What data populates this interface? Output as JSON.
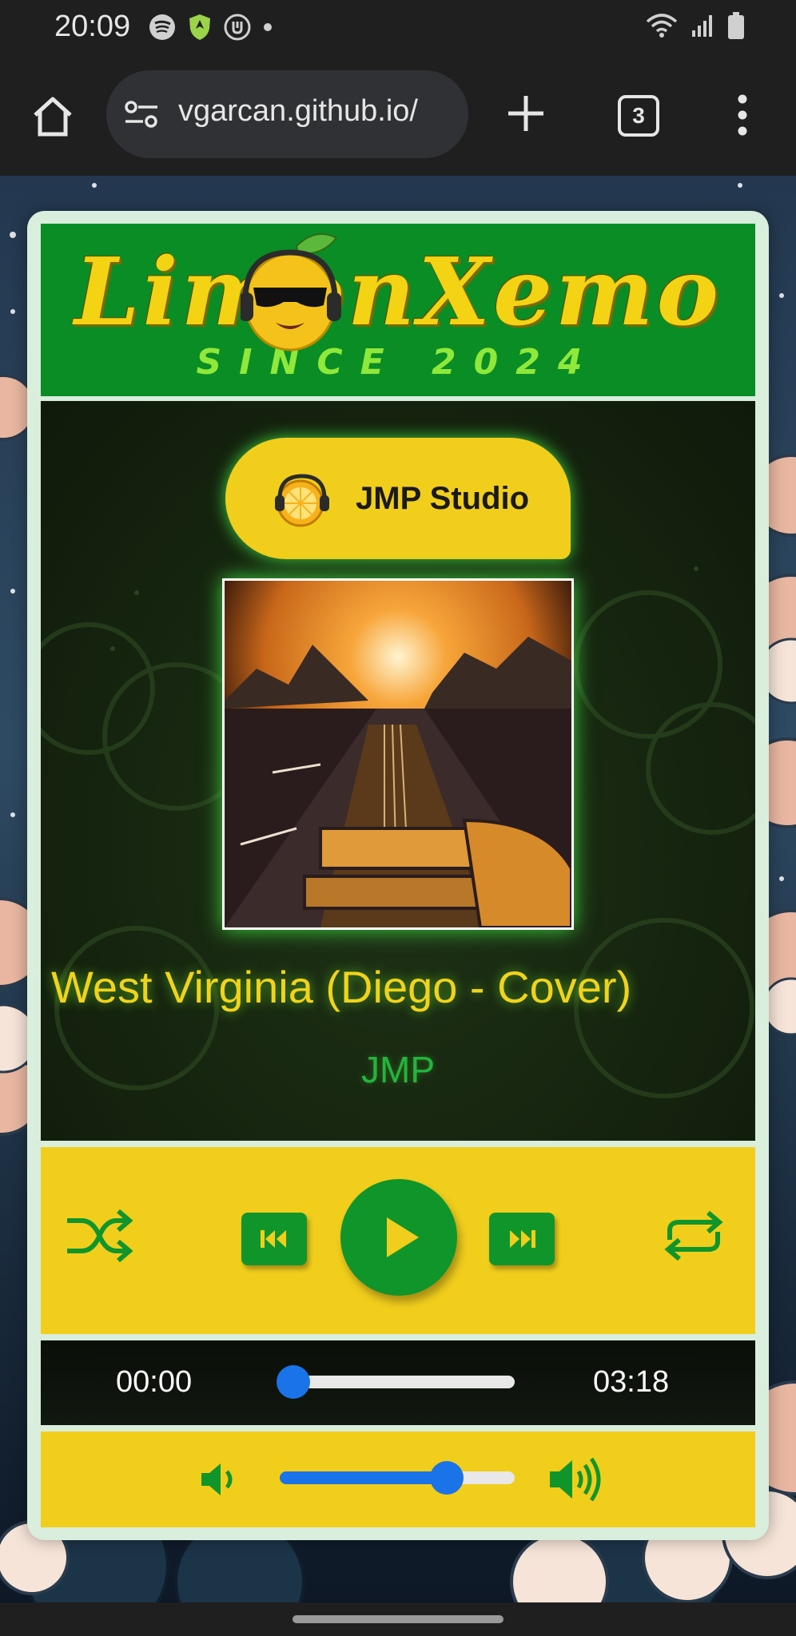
{
  "status_bar": {
    "time": "20:09",
    "icons": [
      "spotify-icon",
      "vpn-shield-icon",
      "clock-app-icon",
      "dot-icon",
      "wifi-icon",
      "signal-icon",
      "battery-icon"
    ]
  },
  "browser": {
    "url": "vgarcan.github.io/",
    "tab_count": "3",
    "icons": [
      "home-icon",
      "site-settings-icon",
      "plus-icon",
      "tabs-icon",
      "more-vert-icon"
    ]
  },
  "banner": {
    "title": "LimonXemo",
    "subtitle": "SINCE 2024"
  },
  "studio": {
    "label": "JMP Studio"
  },
  "track": {
    "title": "West Virginia (Diego - Cover)",
    "artist": "JMP",
    "current_time": "00:00",
    "total_time": "03:18",
    "progress_fraction": 0.0
  },
  "controls": {
    "icons": [
      "shuffle-icon",
      "previous-icon",
      "play-icon",
      "next-icon",
      "repeat-icon"
    ]
  },
  "volume": {
    "level_fraction": 0.71,
    "icons": [
      "volume-low-icon",
      "volume-high-icon"
    ]
  },
  "colors": {
    "brand_green": "#10952b",
    "brand_yellow": "#f1ce1c",
    "slider_blue": "#1a73e8"
  }
}
